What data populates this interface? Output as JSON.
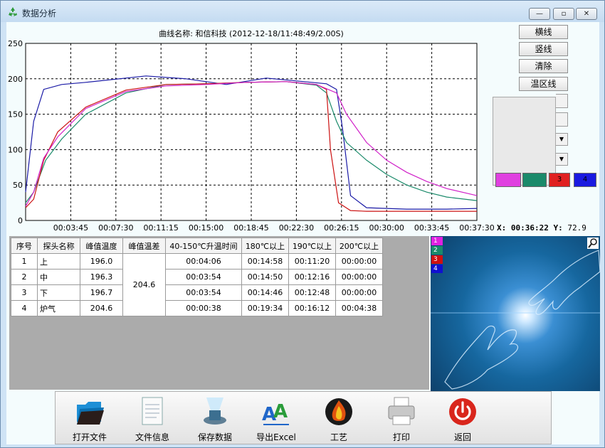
{
  "window": {
    "title": "数据分析",
    "minimize_glyph": "—",
    "maximize_glyph": "▫",
    "close_glyph": "✕"
  },
  "chart_data": {
    "type": "line",
    "title": "曲线名称: 和信科技 (2012-12-18/11:48:49/2.00S)",
    "xlabel": "",
    "ylabel": "",
    "ylim": [
      0,
      250
    ],
    "yticks": [
      0,
      50,
      100,
      150,
      200,
      250
    ],
    "xlim_seconds": [
      0,
      2250
    ],
    "xtick_labels": [
      "00:03:45",
      "00:07:30",
      "00:11:15",
      "00:15:00",
      "00:18:45",
      "00:22:30",
      "00:26:15",
      "00:30:00",
      "00:33:45",
      "00:37:30"
    ],
    "grid": true,
    "series": [
      {
        "color": "#1a1aa6",
        "x": [
          0,
          40,
          90,
          180,
          300,
          600,
          800,
          1000,
          1200,
          1500,
          1550,
          1580,
          1620,
          1700,
          1900,
          2100,
          2250
        ],
        "y": [
          40,
          140,
          185,
          192,
          195,
          204,
          200,
          192,
          201,
          193,
          185,
          130,
          35,
          18,
          16,
          16,
          17
        ]
      },
      {
        "color": "#1a8a6a",
        "x": [
          0,
          40,
          100,
          180,
          300,
          500,
          700,
          900,
          1100,
          1300,
          1450,
          1500,
          1550,
          1600,
          1700,
          1800,
          1900,
          2000,
          2100,
          2250
        ],
        "y": [
          25,
          40,
          85,
          115,
          150,
          180,
          192,
          193,
          195,
          196,
          191,
          180,
          140,
          110,
          85,
          65,
          50,
          40,
          33,
          28
        ]
      },
      {
        "color": "#cc1111",
        "x": [
          0,
          40,
          90,
          160,
          300,
          500,
          700,
          900,
          1100,
          1300,
          1450,
          1500,
          1520,
          1560,
          1620,
          1700,
          1900,
          2250
        ],
        "y": [
          18,
          30,
          85,
          125,
          160,
          184,
          192,
          193,
          195,
          196,
          192,
          185,
          100,
          25,
          14,
          13,
          13,
          13
        ]
      },
      {
        "color": "#d020c8",
        "x": [
          0,
          40,
          90,
          160,
          300,
          500,
          700,
          900,
          1100,
          1300,
          1450,
          1550,
          1600,
          1700,
          1800,
          1900,
          2000,
          2100,
          2250
        ],
        "y": [
          20,
          40,
          88,
          118,
          158,
          182,
          190,
          192,
          195,
          196,
          192,
          180,
          150,
          110,
          85,
          68,
          55,
          45,
          35
        ]
      }
    ]
  },
  "right_buttons": {
    "horizontal_line": "横线",
    "vertical_line": "竖线",
    "clear": "清除",
    "temp_zone_line": "温区线"
  },
  "swatches": [
    {
      "color": "#e040e0",
      "label": ""
    },
    {
      "color": "#1a8a6a",
      "label": ""
    },
    {
      "color": "#e02020",
      "label": "3"
    },
    {
      "color": "#1a1ae0",
      "label": "4"
    }
  ],
  "readout": {
    "x_label": "X:",
    "x_value": "00:36:22",
    "y_label": "Y:",
    "y_value": "72.9"
  },
  "table": {
    "headers": [
      "序号",
      "探头名称",
      "峰值温度",
      "峰值温差",
      "40-150℃升温时间",
      "180℃以上",
      "190℃以上",
      "200℃以上"
    ],
    "peak_diff": "204.6",
    "rows": [
      {
        "no": "1",
        "name": "上",
        "peak": "196.0",
        "rise": "00:04:06",
        "a180": "00:14:58",
        "a190": "00:11:20",
        "a200": "00:00:00"
      },
      {
        "no": "2",
        "name": "中",
        "peak": "196.3",
        "rise": "00:03:54",
        "a180": "00:14:50",
        "a190": "00:12:16",
        "a200": "00:00:00"
      },
      {
        "no": "3",
        "name": "下",
        "peak": "196.7",
        "rise": "00:03:54",
        "a180": "00:14:46",
        "a190": "00:12:48",
        "a200": "00:00:00"
      },
      {
        "no": "4",
        "name": "炉气",
        "peak": "204.6",
        "rise": "00:00:38",
        "a180": "00:19:34",
        "a190": "00:16:12",
        "a200": "00:04:38"
      }
    ]
  },
  "image_legend": [
    {
      "label": "1",
      "color": "#e020e0"
    },
    {
      "label": "2",
      "color": "#1a8a6a"
    },
    {
      "label": "3",
      "color": "#d01010"
    },
    {
      "label": "4",
      "color": "#1010d0"
    }
  ],
  "toolbar": {
    "open_file": "打开文件",
    "file_info": "文件信息",
    "save_data": "保存数据",
    "export_excel": "导出Excel",
    "process": "工艺",
    "print": "打印",
    "back": "返回"
  }
}
